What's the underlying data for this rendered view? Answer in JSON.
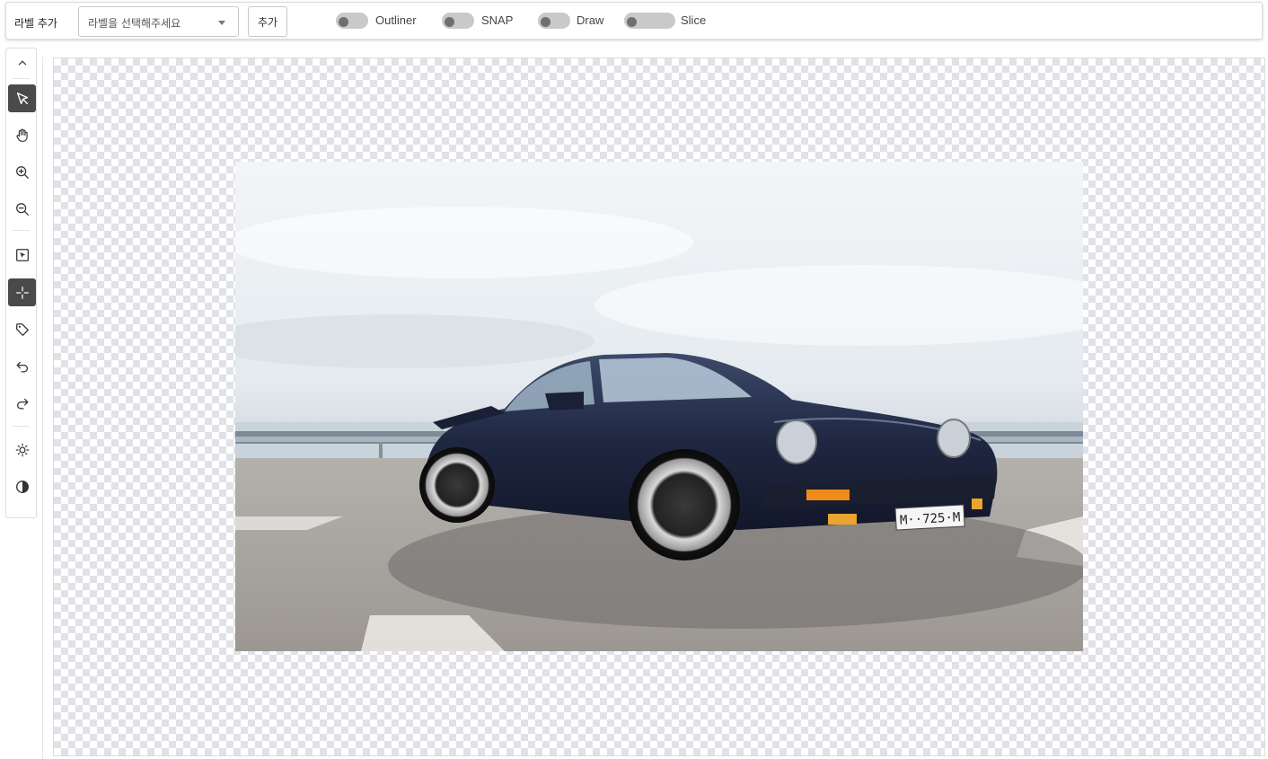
{
  "toolbar": {
    "label_add": "라벨 추가",
    "select_placeholder": "라벨을 선택해주세요",
    "add_button": "추가",
    "toggles": [
      {
        "label": "Outliner",
        "on": false
      },
      {
        "label": "SNAP",
        "on": false
      },
      {
        "label": "Draw",
        "on": false
      },
      {
        "label": "Slice",
        "on": false
      }
    ]
  },
  "tools": [
    {
      "name": "collapse",
      "icon": "chevron-up-icon",
      "active": false
    },
    {
      "name": "pointer",
      "icon": "pointer-icon",
      "active": true
    },
    {
      "name": "pan",
      "icon": "hand-icon",
      "active": false
    },
    {
      "name": "zoom-in",
      "icon": "zoom-in-icon",
      "active": false
    },
    {
      "name": "zoom-out",
      "icon": "zoom-out-icon",
      "active": false
    },
    {
      "name": "select",
      "icon": "select-box-icon",
      "active": false
    },
    {
      "name": "crosshair",
      "icon": "crosshair-icon",
      "active": true
    },
    {
      "name": "tag",
      "icon": "tag-icon",
      "active": false
    },
    {
      "name": "undo",
      "icon": "undo-icon",
      "active": false
    },
    {
      "name": "redo",
      "icon": "redo-icon",
      "active": false
    },
    {
      "name": "brightness",
      "icon": "sun-icon",
      "active": false
    },
    {
      "name": "contrast",
      "icon": "contrast-icon",
      "active": false
    }
  ],
  "colors": {
    "active_tool": "#4a4a4a",
    "toggle_track": "#c9c9c9",
    "toggle_knob": "#6f6f6f",
    "checker": "#e1e1e8"
  },
  "canvas": {
    "image_subject": "dark blue classic sports car on asphalt under cloudy sky"
  }
}
